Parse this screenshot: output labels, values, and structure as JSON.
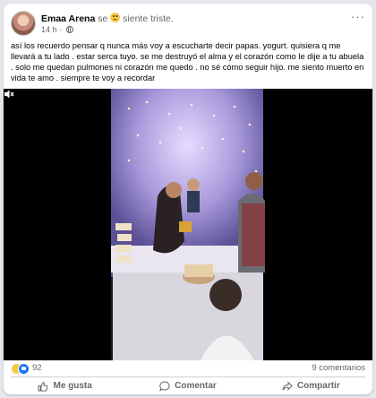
{
  "post": {
    "author": "Emaa Arena",
    "feeling_prefix": "se",
    "feeling_text": "siente triste.",
    "time": "14 h",
    "separator": "·",
    "more_label": "···",
    "text": "así los recuerdo pensar q nunca más voy a escucharte decir papas.  yogurt.  quisiera q me llevará a tu lado . estar serca tuyo. se me destruyó el alma y el corazón como le dije a tu abuela . solo me quedan pulmones ni corazón me quedo . no sé cómo seguir hijo.  me siento muerto en vida te amo . siempre te voy a recordar"
  },
  "video": {
    "muted_icon": "speaker-muted-icon"
  },
  "stats": {
    "reaction_count": "92",
    "comments": "9 comentarios"
  },
  "actions": {
    "like": "Me gusta",
    "comment": "Comentar",
    "share": "Compartir"
  },
  "colors": {
    "brand": "#1877f2",
    "secondary_text": "#65676b",
    "background": "#e4e6eb"
  }
}
